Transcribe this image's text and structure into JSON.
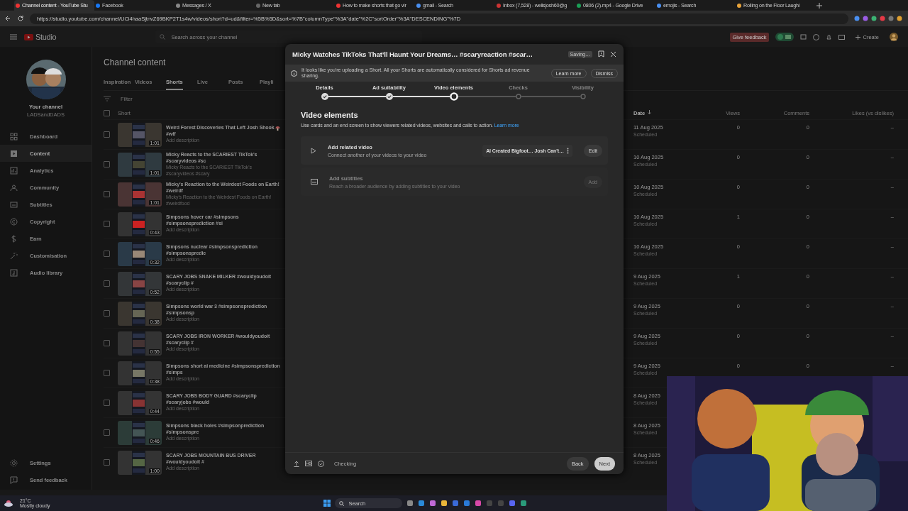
{
  "browser": {
    "tabs": [
      {
        "title": "Channel content - YouTube Stu",
        "selected": true
      },
      {
        "title": "Facebook",
        "selected": false
      },
      {
        "title": "Messages / X",
        "selected": false
      },
      {
        "title": "New tab",
        "selected": false
      },
      {
        "title": "How to make shorts that go vir",
        "selected": false
      },
      {
        "title": "gmail - Search",
        "selected": false
      },
      {
        "title": "Inbox (7,528) - wellsjosh60@g",
        "selected": false
      },
      {
        "title": "0806 (2).mp4 - Google Drive",
        "selected": false
      },
      {
        "title": "emojis - Search",
        "selected": false
      },
      {
        "title": "Rolling on the Floor Laughi",
        "selected": false
      }
    ],
    "url": "https://studio.youtube.com/channel/UCi4haaSjtnvZ69BKP2T1s4w/videos/short?d=ud&filter=%5B%5D&sort=%7B\"columnType\"%3A\"date\"%2C\"sortOrder\"%3A\"DESCENDING\"%7D"
  },
  "header": {
    "brand": "Studio",
    "search": {
      "placeholder": "Search across your channel"
    },
    "feedback": "Give feedback",
    "create": "Create"
  },
  "sidebar": {
    "channel_label": "Your channel",
    "channel_handle": "LADSandDADS",
    "items": [
      {
        "label": "Dashboard",
        "selected": false
      },
      {
        "label": "Content",
        "selected": true
      },
      {
        "label": "Analytics",
        "selected": false
      },
      {
        "label": "Community",
        "selected": false
      },
      {
        "label": "Subtitles",
        "selected": false
      },
      {
        "label": "Copyright",
        "selected": false
      },
      {
        "label": "Earn",
        "selected": false
      },
      {
        "label": "Customisation",
        "selected": false
      },
      {
        "label": "Audio library",
        "selected": false
      }
    ],
    "footer_items": [
      "Settings",
      "Send feedback"
    ]
  },
  "content": {
    "title": "Channel content",
    "tabs": [
      {
        "label": "Inspiration",
        "selected": false
      },
      {
        "label": "Videos",
        "selected": false
      },
      {
        "label": "Shorts",
        "selected": true
      },
      {
        "label": "Live",
        "selected": false
      },
      {
        "label": "Posts",
        "selected": false
      },
      {
        "label": "Playli",
        "selected": false
      }
    ],
    "filter": {
      "placeholder": "Filter"
    },
    "select_all_checked": false,
    "columns": [
      "Short",
      "Date",
      "Views",
      "Comments",
      "Likes (vs dislikes)"
    ],
    "rows": [
      {
        "title": "Weird Forest Discoveries That Left Josh Shook",
        "title_tail": "#wtf",
        "description": "Add description",
        "duration": "1:01",
        "date": "11 Aug 2025",
        "status": "Scheduled",
        "views": "0",
        "comments": "0",
        "likes": "–",
        "checked": false
      },
      {
        "title": "Micky Reacts to the SCARIEST TikTok's #scaryvideos #sc",
        "description": "Micky Reacts to the SCARIEST TikTok's #scaryvideos #scary",
        "duration": "1:01",
        "date": "10 Aug 2025",
        "status": "Scheduled",
        "views": "0",
        "comments": "0",
        "likes": "–",
        "checked": false
      },
      {
        "title": "Micky's Reaction to the Weirdest Foods on Earth! #weirdf",
        "description": "Micky's Reaction to the Weirdest Foods on Earth! #weirdfood",
        "duration": "1:01",
        "date": "10 Aug 2025",
        "status": "Scheduled",
        "views": "0",
        "comments": "0",
        "likes": "–",
        "checked": false
      },
      {
        "title": "Simpsons hover car #simpsons #simpsonsprediction #si",
        "description": "Add description",
        "duration": "0:43",
        "date": "10 Aug 2025",
        "status": "Scheduled",
        "views": "1",
        "comments": "0",
        "likes": "–",
        "checked": false
      },
      {
        "title": "Simpsons nuclear #simpsonsprediction #simpsonspredic",
        "description": "Add description",
        "duration": "0:32",
        "date": "10 Aug 2025",
        "status": "Scheduled",
        "views": "0",
        "comments": "0",
        "likes": "–",
        "checked": false
      },
      {
        "title": "SCARY JOBS SNAKE MILKER #wouldyoudoit #scaryclip #",
        "description": "Add description",
        "duration": "0:52",
        "date": "9 Aug 2025",
        "status": "Scheduled",
        "views": "1",
        "comments": "0",
        "likes": "–",
        "checked": false
      },
      {
        "title": "Simpsons world war 3 #simpsonsprediction #simpsonsp",
        "description": "Add description",
        "duration": "0:38",
        "date": "9 Aug 2025",
        "status": "Scheduled",
        "views": "0",
        "comments": "0",
        "likes": "–",
        "checked": false
      },
      {
        "title": "SCARY JOBS IRON WORKER #wouldyoudoit #scaryclip #",
        "description": "Add description",
        "duration": "0:55",
        "date": "9 Aug 2025",
        "status": "Scheduled",
        "views": "0",
        "comments": "0",
        "likes": "–",
        "checked": false
      },
      {
        "title": "Simpsons short ai medicine #simpsonsprediction #simps",
        "description": "Add description",
        "duration": "0:38",
        "date": "9 Aug 2025",
        "status": "Scheduled",
        "views": "0",
        "comments": "0",
        "likes": "–",
        "checked": false
      },
      {
        "title": "SCARY JOBS BODY GUARD #scaryclip #scaryjobs #would",
        "description": "Add description",
        "duration": "0:44",
        "date": "8 Aug 2025",
        "status": "Scheduled",
        "checked": false
      },
      {
        "title": "Simpsons black holes #simpsonprediction #simpsonspre",
        "description": "Add description",
        "duration": "0:46",
        "date": "8 Aug 2025",
        "status": "Scheduled",
        "checked": false
      },
      {
        "title": "SCARY JOBS MOUNTAIN BUS DRIVER #wouldyoudoit #",
        "description": "Add description",
        "duration": "1:00",
        "date": "8 Aug 2025",
        "status": "Scheduled",
        "checked": false
      }
    ]
  },
  "dialog": {
    "title": "Micky Watches TikToks That’ll Haunt Your Dreams… #scaryreaction #scar…",
    "status_badge": "Saving…",
    "banner": {
      "text": "It looks like you're uploading a Short. All your Shorts are automatically considered for Shorts ad revenue sharing.",
      "actions": [
        "Learn more",
        "Dismiss"
      ]
    },
    "steps": [
      {
        "label": "Details",
        "done": true,
        "current": false
      },
      {
        "label": "Ad suitability",
        "done": true,
        "current": false
      },
      {
        "label": "Video elements",
        "done": false,
        "current": true
      },
      {
        "label": "Checks",
        "done": false,
        "current": false
      },
      {
        "label": "Visibility",
        "done": false,
        "current": false
      }
    ],
    "heading": "Video elements",
    "description": "Use cards and an end screen to show viewers related videos, websites and calls to action.",
    "learn_more": "Learn more",
    "elements": [
      {
        "title": "Add related video",
        "subtitle": "Connect another of your videos to your video",
        "chip": "AI Created Bigfoot… Josh Can't…",
        "action": "Edit",
        "disabled": false
      },
      {
        "title": "Add subtitles",
        "subtitle": "Reach a broader audience by adding subtitles to your video",
        "action": "Add",
        "disabled": true
      }
    ],
    "footer": {
      "status": "Checking",
      "back": "Back",
      "next": "Next"
    }
  },
  "taskbar": {
    "temperature": "21°C",
    "condition": "Mostly cloudy",
    "search": "Search"
  }
}
